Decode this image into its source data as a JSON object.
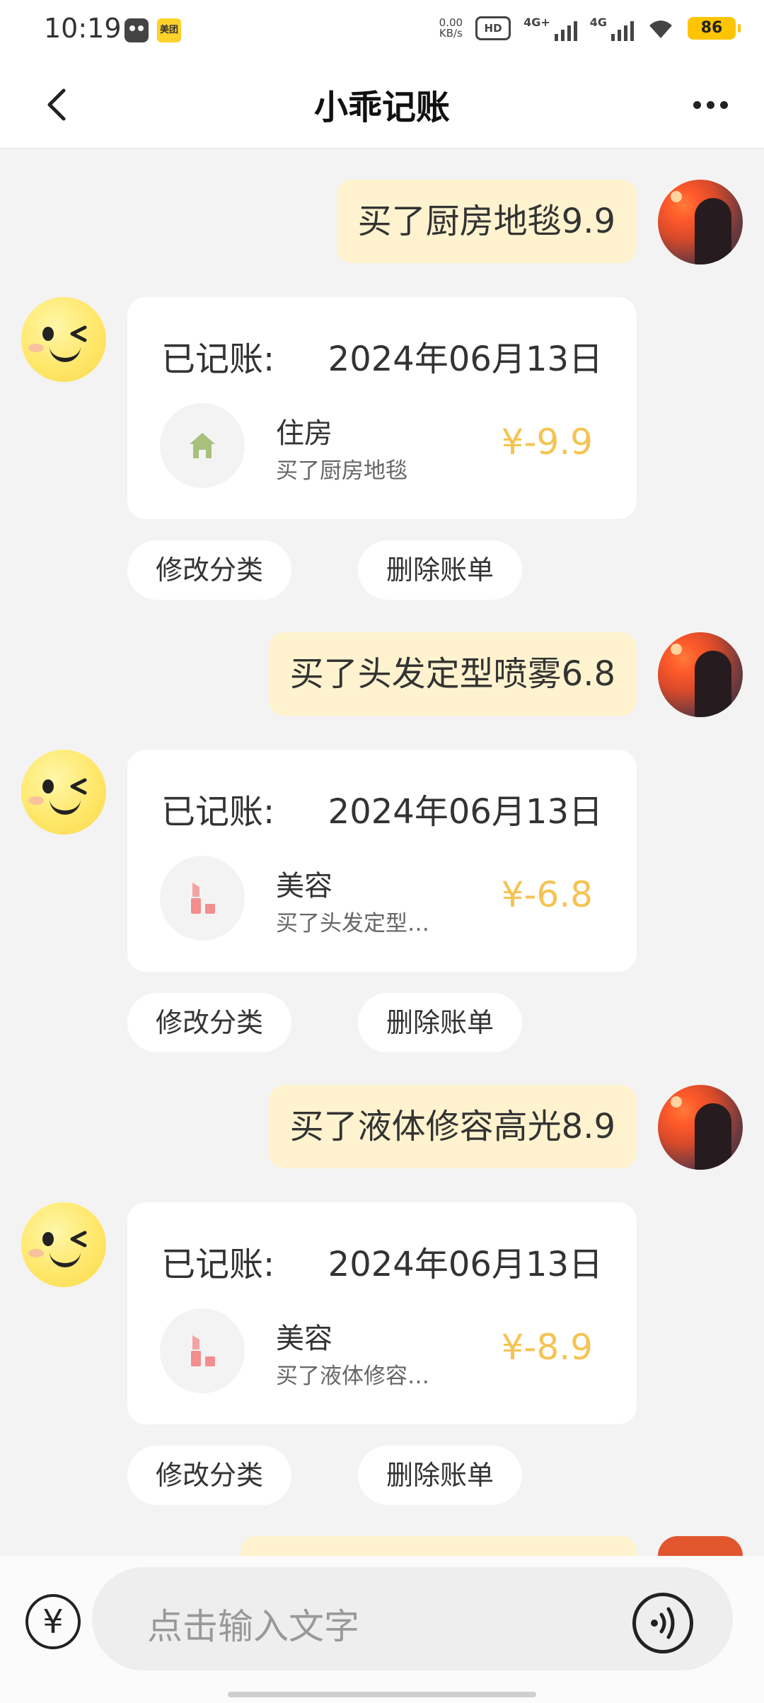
{
  "status_bar": {
    "time": "10:19",
    "app_badge": "美团",
    "net_speed_value": "0.00",
    "net_speed_unit": "KB/s",
    "hd": "HD",
    "sig1": "4G+",
    "sig2": "4G",
    "battery": "86"
  },
  "header": {
    "title": "小乖记账"
  },
  "messages": [
    {
      "user_text": "买了厨房地毯9.9",
      "card": {
        "label": "已记账:",
        "date": "2024年06月13日",
        "category": "住房",
        "note": "买了厨房地毯",
        "amount": "¥-9.9",
        "icon": "house-icon"
      }
    },
    {
      "user_text": "买了头发定型喷雾6.8",
      "card": {
        "label": "已记账:",
        "date": "2024年06月13日",
        "category": "美容",
        "note": "买了头发定型…",
        "amount": "¥-6.8",
        "icon": "lipstick-icon"
      }
    },
    {
      "user_text": "买了液体修容高光8.9",
      "card": {
        "label": "已记账:",
        "date": "2024年06月13日",
        "category": "美容",
        "note": "买了液体修容…",
        "amount": "¥-8.9",
        "icon": "lipstick-icon"
      }
    }
  ],
  "actions": {
    "edit": "修改分类",
    "delete": "删除账单"
  },
  "input": {
    "placeholder": "点击输入文字",
    "yen": "¥"
  },
  "colors": {
    "accent_amount": "#f6c351",
    "user_bubble": "#fff3cf"
  }
}
